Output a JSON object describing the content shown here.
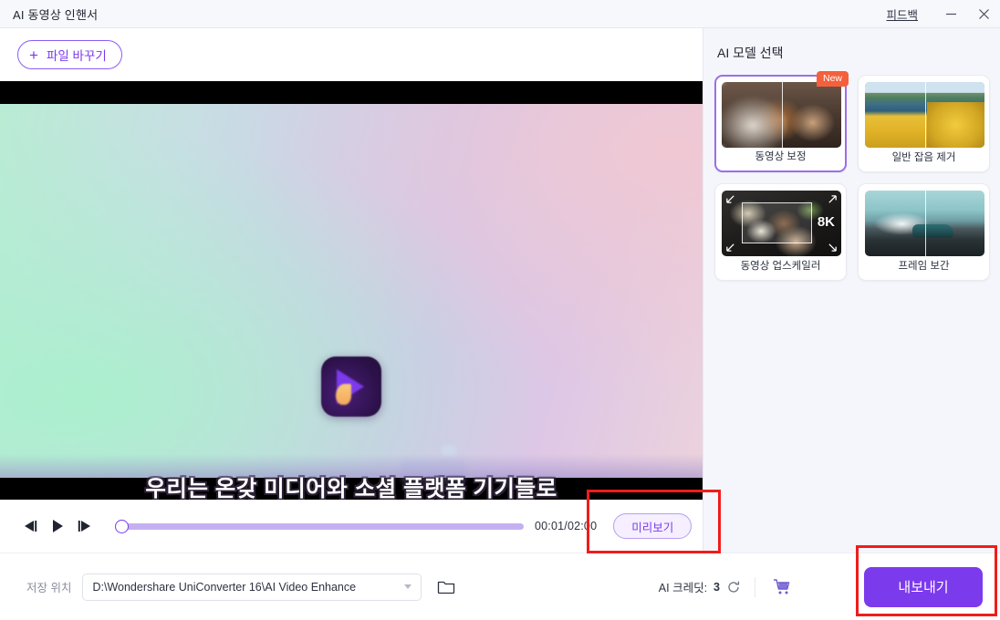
{
  "window": {
    "title": "AI 동영상 인핸서",
    "feedback_label": "피드백",
    "minimize_icon": "minimize-icon",
    "close_icon": "close-icon"
  },
  "toolbar": {
    "replace_file_label": "파일 바꾸기",
    "plus_icon": "plus-icon"
  },
  "video": {
    "subtitle": "우리는 온갖 미디어와 소셜 플랫폼 기기들로",
    "logo_icon": "wondershare-logo-icon"
  },
  "player": {
    "prev_frame_icon": "previous-frame-icon",
    "play_icon": "play-icon",
    "next_frame_icon": "next-frame-icon",
    "timecode": "00:01/02:00",
    "current_time": "00:01",
    "total_time": "02:00",
    "progress_percent": 0,
    "preview_label": "미리보기"
  },
  "panel": {
    "title": "AI 모델 선택",
    "models": [
      {
        "label": "동영상 보정",
        "badge": "New",
        "selected": true,
        "thumb": "pets-photo"
      },
      {
        "label": "일반 잡음 제거",
        "badge": "",
        "selected": false,
        "thumb": "forest-photo"
      },
      {
        "label": "동영상 업스케일러",
        "badge": "8K",
        "selected": false,
        "thumb": "food-photo"
      },
      {
        "label": "프레임 보간",
        "badge": "",
        "selected": false,
        "thumb": "car-photo"
      }
    ]
  },
  "bottom": {
    "save_location_label": "저장 위치",
    "save_path": "D:\\Wondershare UniConverter 16\\AI Video Enhance",
    "folder_icon": "folder-icon",
    "credits_label": "AI 크레딧:",
    "credits_value": "3",
    "refresh_icon": "refresh-icon",
    "cart_icon": "shopping-cart-icon",
    "export_label": "내보내기"
  },
  "colors": {
    "accent_purple": "#7c3aed",
    "light_purple": "#c4b0f0",
    "badge_orange": "#f4603c",
    "annotation_red": "#f01c1c",
    "panel_bg": "#f5f6fb"
  }
}
